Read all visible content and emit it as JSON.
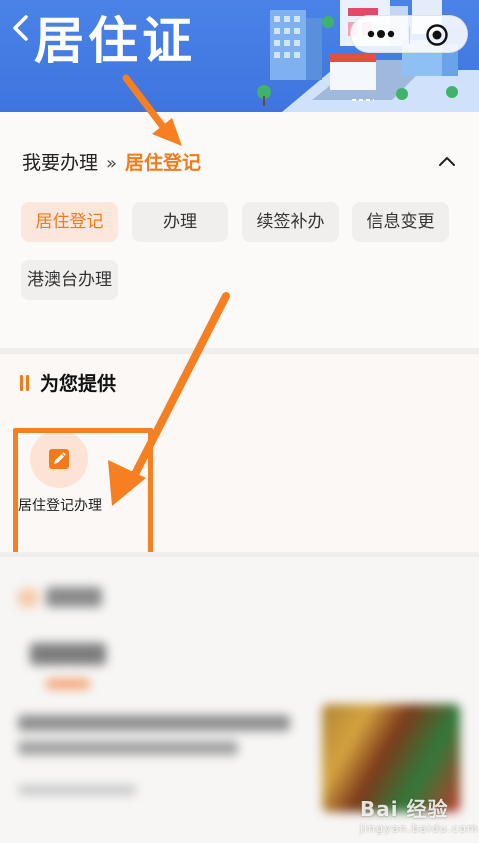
{
  "header": {
    "title": "居住证",
    "back_icon": "chevron-left-icon",
    "colors": {
      "banner": "#4a83e8"
    }
  },
  "capsule": {
    "more_icon": "more-dots-icon",
    "close_icon": "target-circle-icon"
  },
  "breadcrumb": {
    "root": "我要办理",
    "separator": "»",
    "current": "居住登记",
    "toggle_icon": "chevron-up-icon"
  },
  "chips": [
    {
      "label": "居住登记",
      "active": true
    },
    {
      "label": "办理",
      "active": false
    },
    {
      "label": "续签补办",
      "active": false
    },
    {
      "label": "信息变更",
      "active": false
    },
    {
      "label": "港澳台办理",
      "active": false
    }
  ],
  "provide_section": {
    "title": "为您提供",
    "services": [
      {
        "label": "居住登记办理",
        "icon": "edit-icon"
      }
    ]
  },
  "watermark": {
    "text": "Bai  经验",
    "sub": "jingyan.baidu.com"
  },
  "colors": {
    "accent": "#f07b1d",
    "annotation": "#f57f21"
  }
}
